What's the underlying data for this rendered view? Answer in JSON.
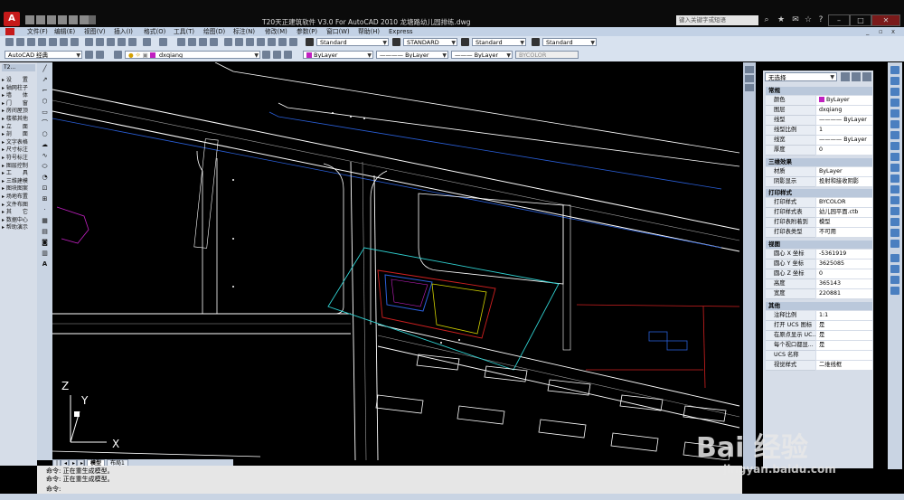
{
  "window": {
    "title": "T20天正建筑软件 V3.0 For AutoCAD 2010      龙塘路幼儿园排练.dwg",
    "search_placeholder": "键入关键字或短语"
  },
  "menu": [
    "文件(F)",
    "编辑(E)",
    "视图(V)",
    "插入(I)",
    "格式(O)",
    "工具(T)",
    "绘图(D)",
    "标注(N)",
    "修改(M)",
    "参数(P)",
    "窗口(W)",
    "帮助(H)",
    "Express"
  ],
  "toolbar1": {
    "text_style": "Standard",
    "dim_style": "STANDARD",
    "table_style": "Standard",
    "mleader_style": "Standard"
  },
  "toolbar2": {
    "workspace": "AutoCAD 经典",
    "layer": "dxqiang",
    "color": "ByLayer",
    "linetype": "ByLayer",
    "lineweight": "ByLayer",
    "plotstyle": "BYCOLOR"
  },
  "t20_panel": {
    "title": "T2...",
    "items": [
      "设　　置",
      "轴网柱子",
      "墙　　体",
      "门　　窗",
      "房间屋顶",
      "楼梯其他",
      "立　　面",
      "剖　　面",
      "文字表格",
      "尺寸标注",
      "符号标注",
      "图层控制",
      "工　　具",
      "三维建模",
      "图块图案",
      "场地布置",
      "文件布图",
      "其　　它",
      "数据中心",
      "帮助演示"
    ]
  },
  "properties": {
    "selection": "无选择",
    "sections": {
      "general": "常规",
      "threed": "三维效果",
      "plot": "打印样式",
      "view": "视图",
      "misc": "其他"
    },
    "general": [
      {
        "key": "颜色",
        "value": "ByLayer"
      },
      {
        "key": "图层",
        "value": "dxqiang"
      },
      {
        "key": "线型",
        "value": "———— ByLayer"
      },
      {
        "key": "线型比例",
        "value": "1"
      },
      {
        "key": "线宽",
        "value": "———— ByLayer"
      },
      {
        "key": "厚度",
        "value": "0"
      }
    ],
    "threed": [
      {
        "key": "材质",
        "value": "ByLayer"
      },
      {
        "key": "阴影显示",
        "value": "投射和接收阴影"
      }
    ],
    "plot": [
      {
        "key": "打印样式",
        "value": "BYCOLOR"
      },
      {
        "key": "打印样式表",
        "value": "幼儿园平面.ctb"
      },
      {
        "key": "打印表附着到",
        "value": "模型"
      },
      {
        "key": "打印表类型",
        "value": "不可用"
      }
    ],
    "view": [
      {
        "key": "圆心 X 坐标",
        "value": "-5361919"
      },
      {
        "key": "圆心 Y 坐标",
        "value": "3625085"
      },
      {
        "key": "圆心 Z 坐标",
        "value": "0"
      },
      {
        "key": "高度",
        "value": "365143"
      },
      {
        "key": "宽度",
        "value": "220881"
      }
    ],
    "misc": [
      {
        "key": "注释比例",
        "value": "1:1"
      },
      {
        "key": "打开 UCS 图标",
        "value": "是"
      },
      {
        "key": "在原点显示 UC...",
        "value": "是"
      },
      {
        "key": "每个视口都显...",
        "value": "是"
      },
      {
        "key": "UCS 名称",
        "value": ""
      },
      {
        "key": "视觉样式",
        "value": "二维线框"
      }
    ]
  },
  "tabs": [
    "模型",
    "布局1"
  ],
  "ucs": {
    "x": "X",
    "y": "Y",
    "z": "Z"
  },
  "command_lines": [
    "命令:  正在重生成模型。",
    "命令:  正在重生成模型。",
    "命令:"
  ],
  "colors": {
    "menubar": "#c2d1e5",
    "toolbar": "#d8e2ef",
    "canvas": "#000000",
    "road_white": "#ffffff",
    "road_blue": "#2a5fd8",
    "site_cyan": "#30d0d0",
    "red_line": "#d02020",
    "magenta": "#c020c0"
  },
  "watermark": {
    "brand": "Bai 经验",
    "url": "jingyan.baidu.com"
  }
}
